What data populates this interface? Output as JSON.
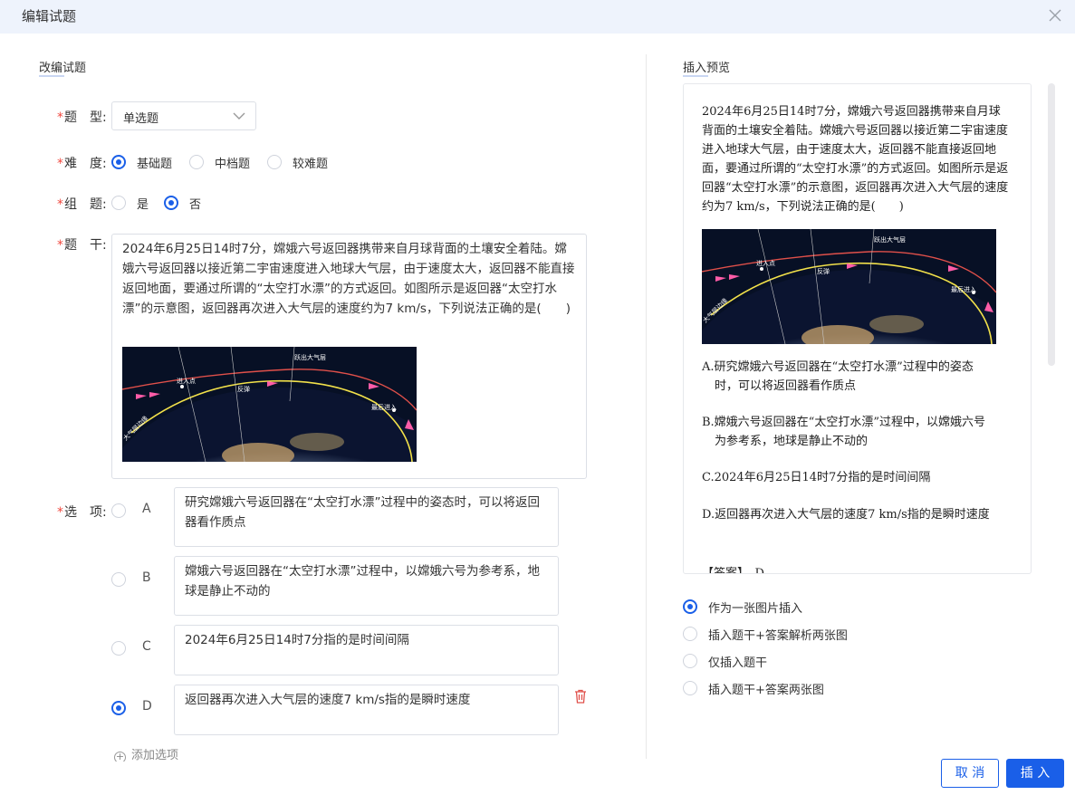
{
  "dialog": {
    "title": "编辑试题"
  },
  "left": {
    "section_title": "改编试题",
    "type_label": "题　型:",
    "type_value": "单选题",
    "difficulty_label": "难　度:",
    "difficulty_options": [
      "基础题",
      "中档题",
      "较难题"
    ],
    "difficulty_selected": "基础题",
    "group_label": "组　题:",
    "group_options": [
      "是",
      "否"
    ],
    "group_selected": "否",
    "stem_label": "题　干:",
    "stem_text": "2024年6月25日14时7分，嫦娥六号返回器携带来自月球背面的土壤安全着陆。嫦娥六号返回器以接近第二宇宙速度进入地球大气层，由于速度太大，返回器不能直接返回地面，要通过所谓的“太空打水漂”的方式返回。如图所示是返回器“太空打水漂”的示意图，返回器再次进入大气层的速度约为7 km/s，下列说法正确的是(　　)",
    "figure_labels": {
      "enter": "进入点",
      "bounce": "反弹",
      "exit": "跃出大气层",
      "final": "最后进入",
      "atmosphere": "大气层边缘"
    },
    "options_label": "选　项:",
    "options": [
      {
        "letter": "A",
        "text": "研究嫦娥六号返回器在“太空打水漂”过程中的姿态时，可以将返回器看作质点"
      },
      {
        "letter": "B",
        "text": "嫦娥六号返回器在“太空打水漂”过程中，以嫦娥六号为参考系，地球是静止不动的"
      },
      {
        "letter": "C",
        "text": "2024年6月25日14时7分指的是时间间隔"
      },
      {
        "letter": "D",
        "text": "返回器再次进入大气层的速度7 km/s指的是瞬时速度"
      }
    ],
    "correct_option": "D",
    "add_option_label": "添加选项"
  },
  "right": {
    "section_title": "插入预览",
    "preview_stem": "2024年6月25日14时7分，嫦娥六号返回器携带来自月球背面的土壤安全着陆。嫦娥六号返回器以接近第二宇宙速度进入地球大气层，由于速度太大，返回器不能直接返回地面，要通过所谓的“太空打水漂”的方式返回。如图所示是返回器“太空打水漂”的示意图，返回器再次进入大气层的速度约为7 km/s，下列说法正确的是(　　)",
    "preview_options": [
      {
        "first": "A.研究嫦娥六号返回器在“太空打水漂”过程中的姿态",
        "rest": "时，可以将返回器看作质点"
      },
      {
        "first": "B.嫦娥六号返回器在“太空打水漂”过程中，以嫦娥六号",
        "rest": "为参考系，地球是静止不动的"
      },
      {
        "first": "C.2024年6月25日14时7分指的是时间间隔",
        "rest": ""
      },
      {
        "first": "D.返回器再次进入大气层的速度7 km/s指的是瞬时速度",
        "rest": ""
      }
    ],
    "answer_partial": "【答案】　D",
    "insert_modes": [
      "作为一张图片插入",
      "插入题干+答案解析两张图",
      "仅插入题干",
      "插入题干+答案两张图"
    ],
    "insert_mode_selected": "作为一张图片插入"
  },
  "buttons": {
    "cancel": "取 消",
    "insert": "插 入"
  },
  "colors": {
    "primary": "#1a5fe8",
    "required": "#f0483e",
    "header_bg": "#eef3fc",
    "trash": "#e0504a"
  }
}
